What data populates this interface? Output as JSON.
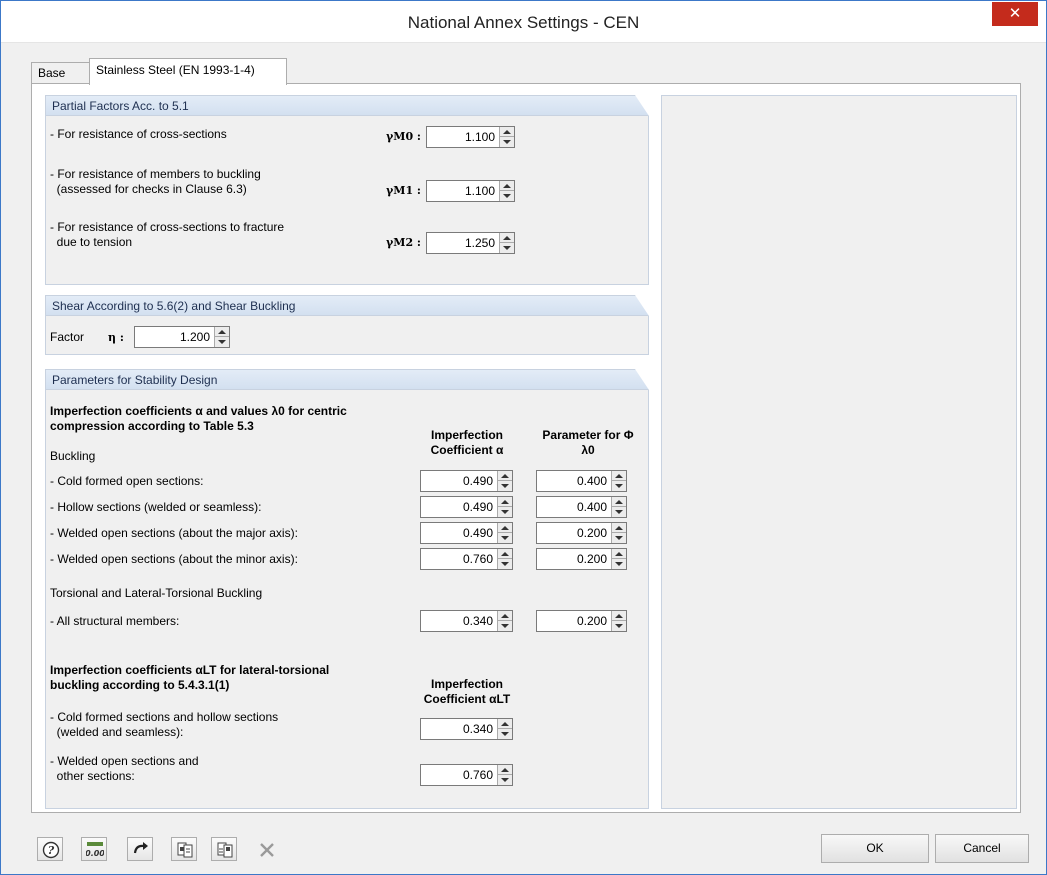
{
  "window": {
    "title": "National Annex Settings - CEN",
    "close_symbol": "✕"
  },
  "tabs": [
    {
      "label": "Base"
    },
    {
      "label": "Stainless Steel (EN 1993-1-4)"
    }
  ],
  "partial_factors": {
    "header": "Partial Factors Acc. to 5.1",
    "rows": [
      {
        "label": "- For resistance of cross-sections",
        "symbol": "γM0 :",
        "value": "1.100"
      },
      {
        "label": "- For resistance of members to buckling\n  (assessed for checks in Clause 6.3)",
        "symbol": "γM1 :",
        "value": "1.100"
      },
      {
        "label": "- For resistance of cross-sections to fracture\n  due to tension",
        "symbol": "γM2 :",
        "value": "1.250"
      }
    ]
  },
  "shear": {
    "header": "Shear According to 5.6(2) and Shear Buckling",
    "factor_label": "Factor",
    "symbol": "η :",
    "value": "1.200"
  },
  "stability": {
    "header": "Parameters for Stability Design",
    "intro": "Imperfection coefficients α and values λ0 for centric\ncompression according to Table 5.3",
    "col_alpha": "Imperfection\nCoefficient α",
    "col_lambda": "Parameter for Φ\nλ0",
    "buckling_heading": "Buckling",
    "buckling_rows": [
      {
        "label": "- Cold formed open sections:",
        "alpha": "0.490",
        "lambda": "0.400"
      },
      {
        "label": "- Hollow sections (welded or seamless):",
        "alpha": "0.490",
        "lambda": "0.400"
      },
      {
        "label": "- Welded open sections (about the major axis):",
        "alpha": "0.490",
        "lambda": "0.200"
      },
      {
        "label": "- Welded open sections (about the minor axis):",
        "alpha": "0.760",
        "lambda": "0.200"
      }
    ],
    "torsional_heading": "Torsional and Lateral-Torsional Buckling",
    "torsional_row": {
      "label": "- All structural members:",
      "alpha": "0.340",
      "lambda": "0.200"
    },
    "lt_intro": "Imperfection coefficients αLT for lateral-torsional\nbuckling according to 5.4.3.1(1)",
    "col_alpha_lt": "Imperfection\nCoefficient αLT",
    "lt_rows": [
      {
        "label": "- Cold formed sections and hollow sections\n  (welded and seamless):",
        "value": "0.340"
      },
      {
        "label": "- Welded open sections and\n  other sections:",
        "value": "0.760"
      }
    ]
  },
  "toolbar": {
    "icons": [
      "help-icon",
      "decimal-places-icon",
      "reset-defaults-icon",
      "export-icon",
      "import-icon",
      "delete-icon"
    ],
    "decimal_label": "0.00"
  },
  "buttons": {
    "ok": "OK",
    "cancel": "Cancel"
  },
  "colors": {
    "close": "#c42b1c",
    "group_header": "#d3e0f0",
    "border_accent": "#3c78c8"
  }
}
